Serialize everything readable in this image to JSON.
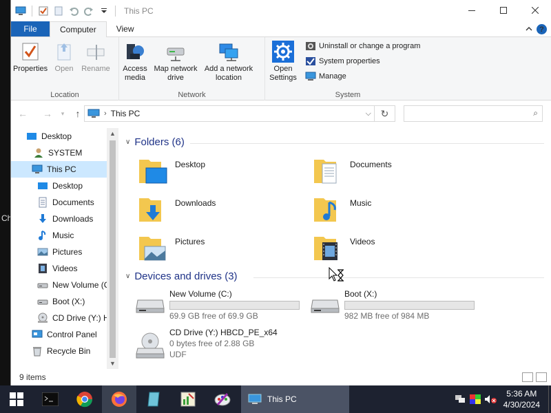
{
  "desktop_fragment": "Ch",
  "titlebar": {
    "title": "This PC"
  },
  "ribbon": {
    "tabs": [
      "File",
      "Computer",
      "View"
    ],
    "location": {
      "label": "Location",
      "properties": "Properties",
      "open": "Open",
      "rename": "Rename"
    },
    "network": {
      "label": "Network",
      "access_media": "Access media",
      "map_drive": "Map network drive",
      "add_location": "Add a network location"
    },
    "system": {
      "label": "System",
      "open_settings": "Open Settings",
      "uninstall": "Uninstall or change a program",
      "system_properties": "System properties",
      "manage": "Manage"
    }
  },
  "address": {
    "path": "This PC"
  },
  "nav": {
    "items": [
      {
        "label": "Desktop"
      },
      {
        "label": "SYSTEM"
      },
      {
        "label": "This PC"
      },
      {
        "label": "Desktop"
      },
      {
        "label": "Documents"
      },
      {
        "label": "Downloads"
      },
      {
        "label": "Music"
      },
      {
        "label": "Pictures"
      },
      {
        "label": "Videos"
      },
      {
        "label": "New Volume (C"
      },
      {
        "label": "Boot (X:)"
      },
      {
        "label": "CD Drive (Y:) H"
      },
      {
        "label": "Control Panel"
      },
      {
        "label": "Recycle Bin"
      }
    ]
  },
  "folders": {
    "header": "Folders (6)",
    "items": [
      {
        "name": "Desktop"
      },
      {
        "name": "Documents"
      },
      {
        "name": "Downloads"
      },
      {
        "name": "Music"
      },
      {
        "name": "Pictures"
      },
      {
        "name": "Videos"
      }
    ]
  },
  "drives": {
    "header": "Devices and drives (3)",
    "items": [
      {
        "name": "New Volume (C:)",
        "free": "69.9 GB free of 69.9 GB",
        "used_fraction": 0.0
      },
      {
        "name": "Boot (X:)",
        "free": "982 MB free of 984 MB",
        "used_fraction": 0.0
      },
      {
        "name": "CD Drive (Y:) HBCD_PE_x64",
        "free": "0 bytes free of 2.88 GB",
        "fs": "UDF"
      }
    ]
  },
  "status": {
    "items": "9 items"
  },
  "taskbar": {
    "window_label": "This PC",
    "time": "5:36 AM",
    "date": "4/30/2024"
  },
  "colors": {
    "accent": "#1a64b8",
    "folder": "#f3c74f",
    "header": "#1e3287",
    "selection": "#cce8ff"
  }
}
